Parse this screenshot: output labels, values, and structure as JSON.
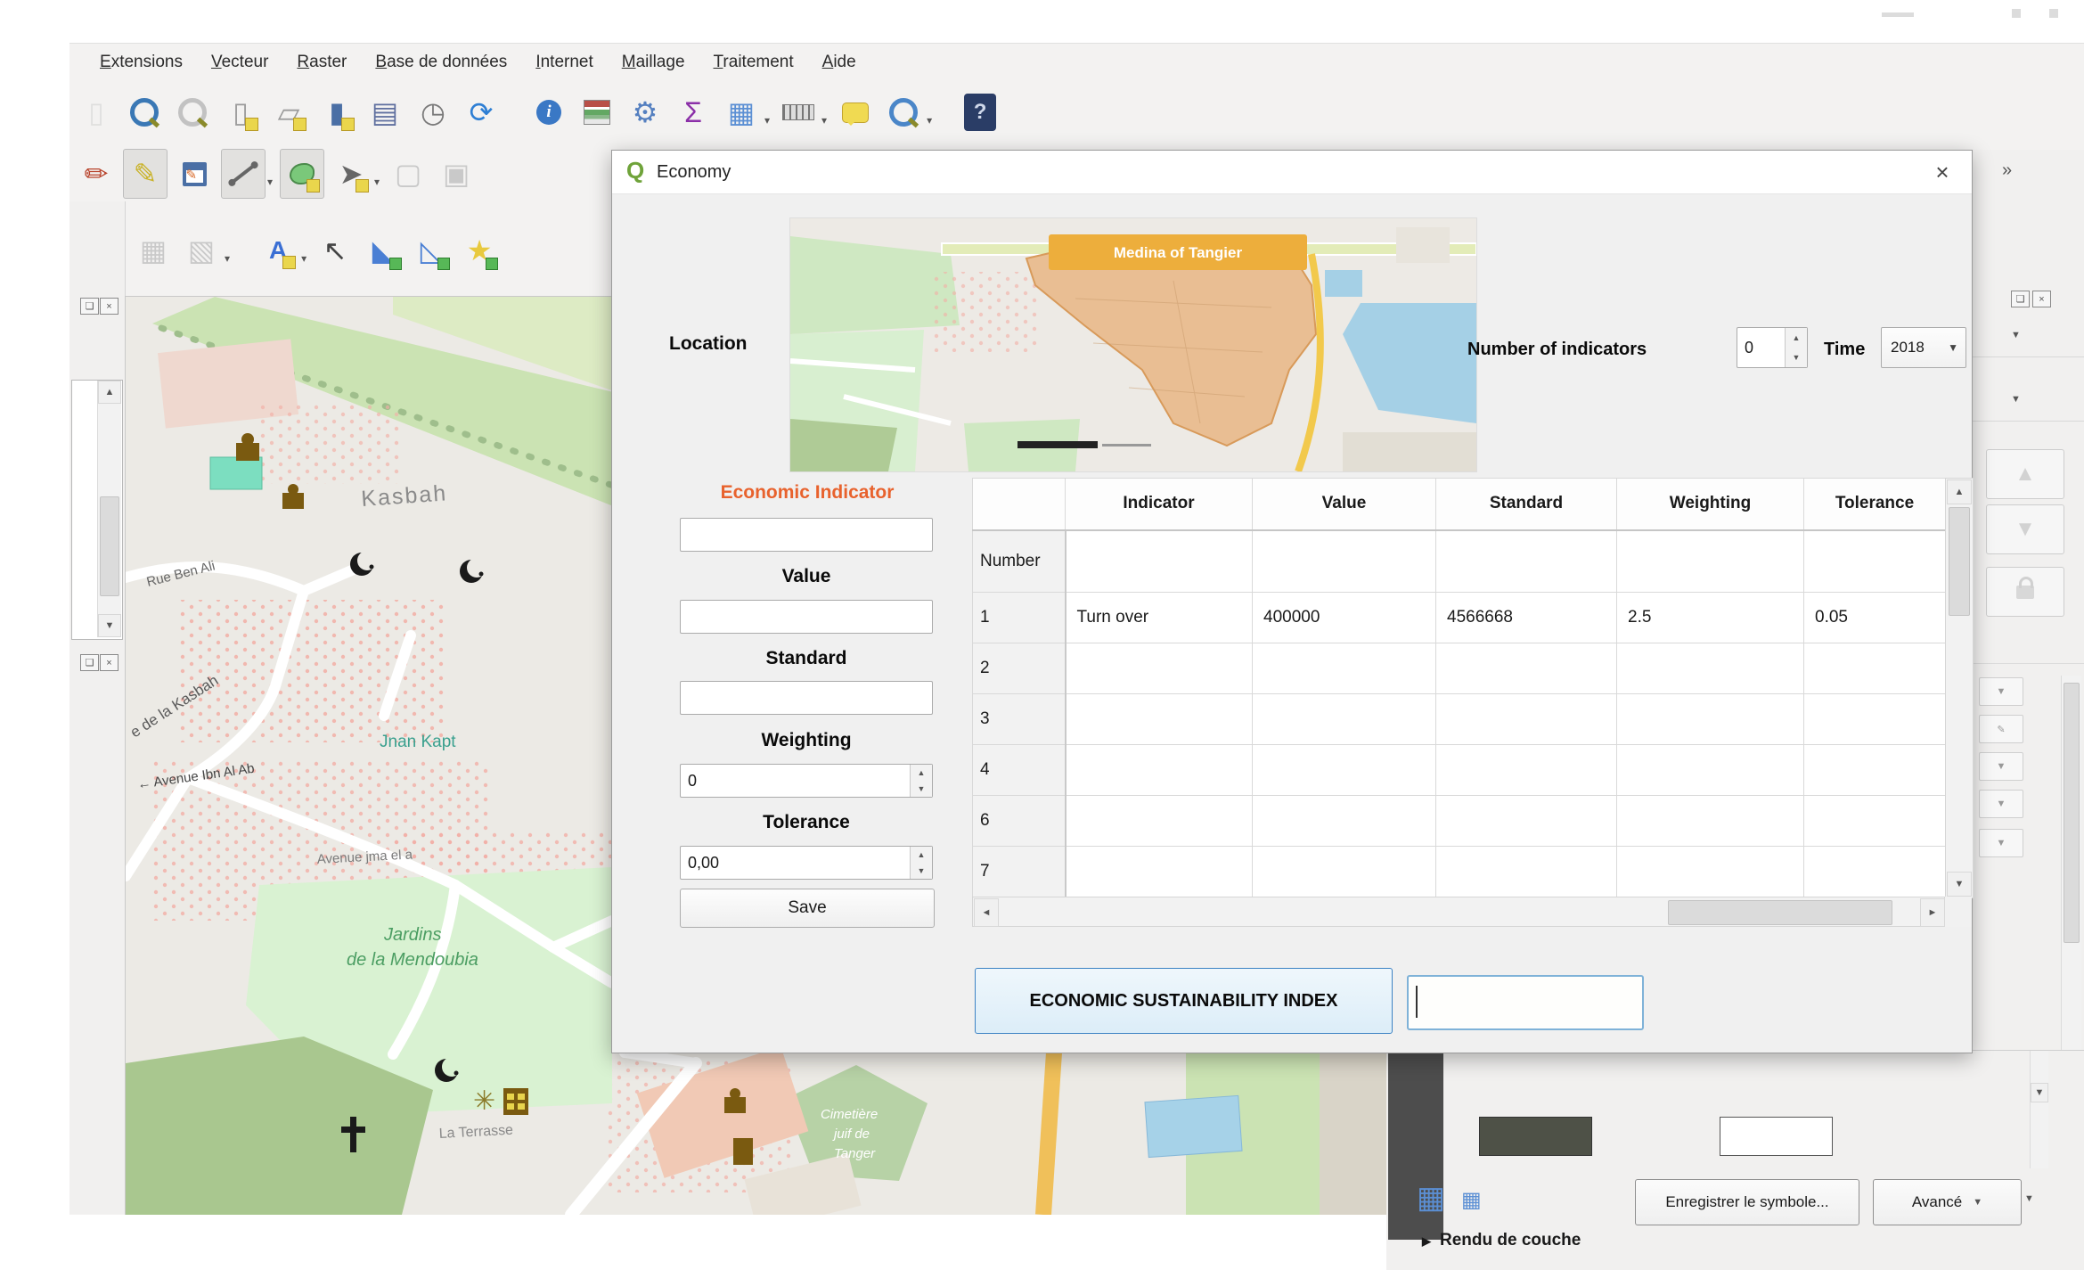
{
  "menu": {
    "items": [
      "Extensions",
      "Vecteur",
      "Raster",
      "Base de données",
      "Internet",
      "Maillage",
      "Traitement",
      "Aide"
    ]
  },
  "toolbars": {
    "row1": [
      {
        "name": "new-project-icon",
        "glyph": "▯",
        "color": "#c9c9c9",
        "faded": true
      },
      {
        "name": "zoom-last-icon",
        "kind": "mag",
        "color": "#3a78b5"
      },
      {
        "name": "zoom-next-icon",
        "kind": "mag",
        "color": "#c2c2c2"
      },
      {
        "name": "new-geopackage-layer-icon",
        "glyph": "▯",
        "color": "#9a9a9a",
        "badge": true
      },
      {
        "name": "new-shapefile-layer-icon",
        "glyph": "▱",
        "color": "#9a9a9a",
        "badge": true
      },
      {
        "name": "new-spatialite-layer-icon",
        "glyph": "▮",
        "color": "#4a6fa5",
        "badge": true
      },
      {
        "name": "show-bookmarks-icon",
        "glyph": "▤",
        "color": "#5f6f9f"
      },
      {
        "name": "temporal-controller-icon",
        "glyph": "◷",
        "color": "#7a7a7a"
      },
      {
        "name": "refresh-icon",
        "glyph": "⟳",
        "color": "#2e7fd4"
      },
      {
        "gap": true
      },
      {
        "name": "identify-features-icon",
        "circle": true,
        "color": "#3a78c5"
      },
      {
        "name": "open-attribute-table-icon",
        "kind": "grid3"
      },
      {
        "name": "processing-toolbox-icon",
        "glyph": "⚙",
        "color": "#5580c0"
      },
      {
        "name": "statistical-summary-icon",
        "glyph": "Σ",
        "color": "#8b2fa8"
      },
      {
        "name": "open-table-icon",
        "glyph": "▦",
        "color": "#5b8fd4",
        "dd": true
      },
      {
        "name": "measure-icon",
        "kind": "ruler",
        "dd": true
      },
      {
        "name": "map-tips-icon",
        "kind": "bubble"
      },
      {
        "name": "zoom-search-icon",
        "kind": "mag",
        "color": "#4a86c8",
        "dd": true
      },
      {
        "gap": true
      },
      {
        "name": "help-icon",
        "helpbox": true
      }
    ],
    "row2": [
      {
        "name": "current-edits-icon",
        "glyph": "✏",
        "color": "#b8442c"
      },
      {
        "name": "toggle-editing-icon",
        "glyph": "✎",
        "color": "#c9b227",
        "pressed": true
      },
      {
        "name": "save-layer-edits-icon",
        "kind": "floppy"
      },
      {
        "name": "digitize-segment-icon",
        "kind": "seg",
        "pressed": true,
        "dd": true
      },
      {
        "name": "add-polygon-feature-icon",
        "kind": "blob",
        "pressed": true,
        "badge": true
      },
      {
        "name": "vertex-tool-icon",
        "glyph": "➤",
        "color": "#666",
        "badge": true,
        "dd": true
      },
      {
        "name": "cut-features-icon",
        "glyph": "▢",
        "color": "#c9c9c9"
      },
      {
        "name": "copy-features-icon",
        "glyph": "▣",
        "color": "#c9c9c9"
      }
    ],
    "row3": [
      {
        "name": "annotation-toolbar-icon",
        "glyph": "▭",
        "color": "#9a9a9a",
        "dd": true
      },
      {
        "name": "diagram-options-icon",
        "glyph": "▦",
        "color": "#c9c9c9"
      },
      {
        "name": "layer-diagram-icon",
        "glyph": "▧",
        "color": "#c9c9c9",
        "dd": true
      },
      {
        "gap": true
      },
      {
        "name": "layer-labeling-icon",
        "kind": "labelA",
        "badge": true,
        "dd": true
      },
      {
        "name": "move-label-icon",
        "glyph": "↖",
        "color": "#444"
      },
      {
        "name": "add-ring-icon",
        "glyph": "◣",
        "color": "#4a7fd4",
        "badge2": true
      },
      {
        "name": "add-part-icon",
        "glyph": "◺",
        "color": "#4a7fd4",
        "badge2": true
      },
      {
        "name": "rotate-feature-icon",
        "glyph": "★",
        "color": "#e8c93e",
        "badge2": true
      }
    ]
  },
  "map": {
    "labels": {
      "kasbah": "Kasbah",
      "jnan_kapt": "Jnan Kapt",
      "rue_kasbah": "e de la Kasbah",
      "rue_ben": "Rue Ben Ali",
      "avenue_ibn": "← Avenue Ibn Al Ab",
      "avenue_jma": "Avenue jma el a",
      "jardins_1": "Jardins",
      "jardins_2": "de la Mendoubia",
      "la_terrasse": "La Terrasse",
      "cimetiere_1": "Cimetière",
      "cimetiere_2": "juif de",
      "cimetiere_3": "Tanger"
    }
  },
  "dialog": {
    "title": "Economy",
    "close": "×",
    "location_label": "Location",
    "map_badge": "Medina of Tangier",
    "indicators_label": "Number of indicators",
    "indicators_value": "0",
    "time_label": "Time",
    "time_value": "2018",
    "form": {
      "indicator_label": "Economic Indicator",
      "value_label": "Value",
      "standard_label": "Standard",
      "weighting_label": "Weighting",
      "weighting_value": "0",
      "tolerance_label": "Tolerance",
      "tolerance_value": "0,00",
      "save_label": "Save"
    },
    "table": {
      "columns": [
        "Indicator",
        "Value",
        "Standard",
        "Weighting",
        "Tolerance"
      ],
      "row_headers": [
        "Number",
        "1",
        "2",
        "3",
        "4",
        "6",
        "7"
      ],
      "rows": [
        [
          "",
          "",
          "",
          "",
          ""
        ],
        [
          "Turn over",
          "400000",
          "4566668",
          "2.5",
          "0.05"
        ],
        [
          "",
          "",
          "",
          "",
          ""
        ],
        [
          "",
          "",
          "",
          "",
          ""
        ],
        [
          "",
          "",
          "",
          "",
          ""
        ],
        [
          "",
          "",
          "",
          "",
          ""
        ],
        [
          "",
          "",
          "",
          "",
          ""
        ]
      ]
    },
    "esi_label": "ECONOMIC SUSTAINABILITY INDEX"
  },
  "right_strip": {
    "overflow": "»"
  },
  "style_panel": {
    "save_symbol": "Enregistrer le symbole...",
    "advanced": "Avancé",
    "layer_rendering": "Rendu de couche"
  }
}
